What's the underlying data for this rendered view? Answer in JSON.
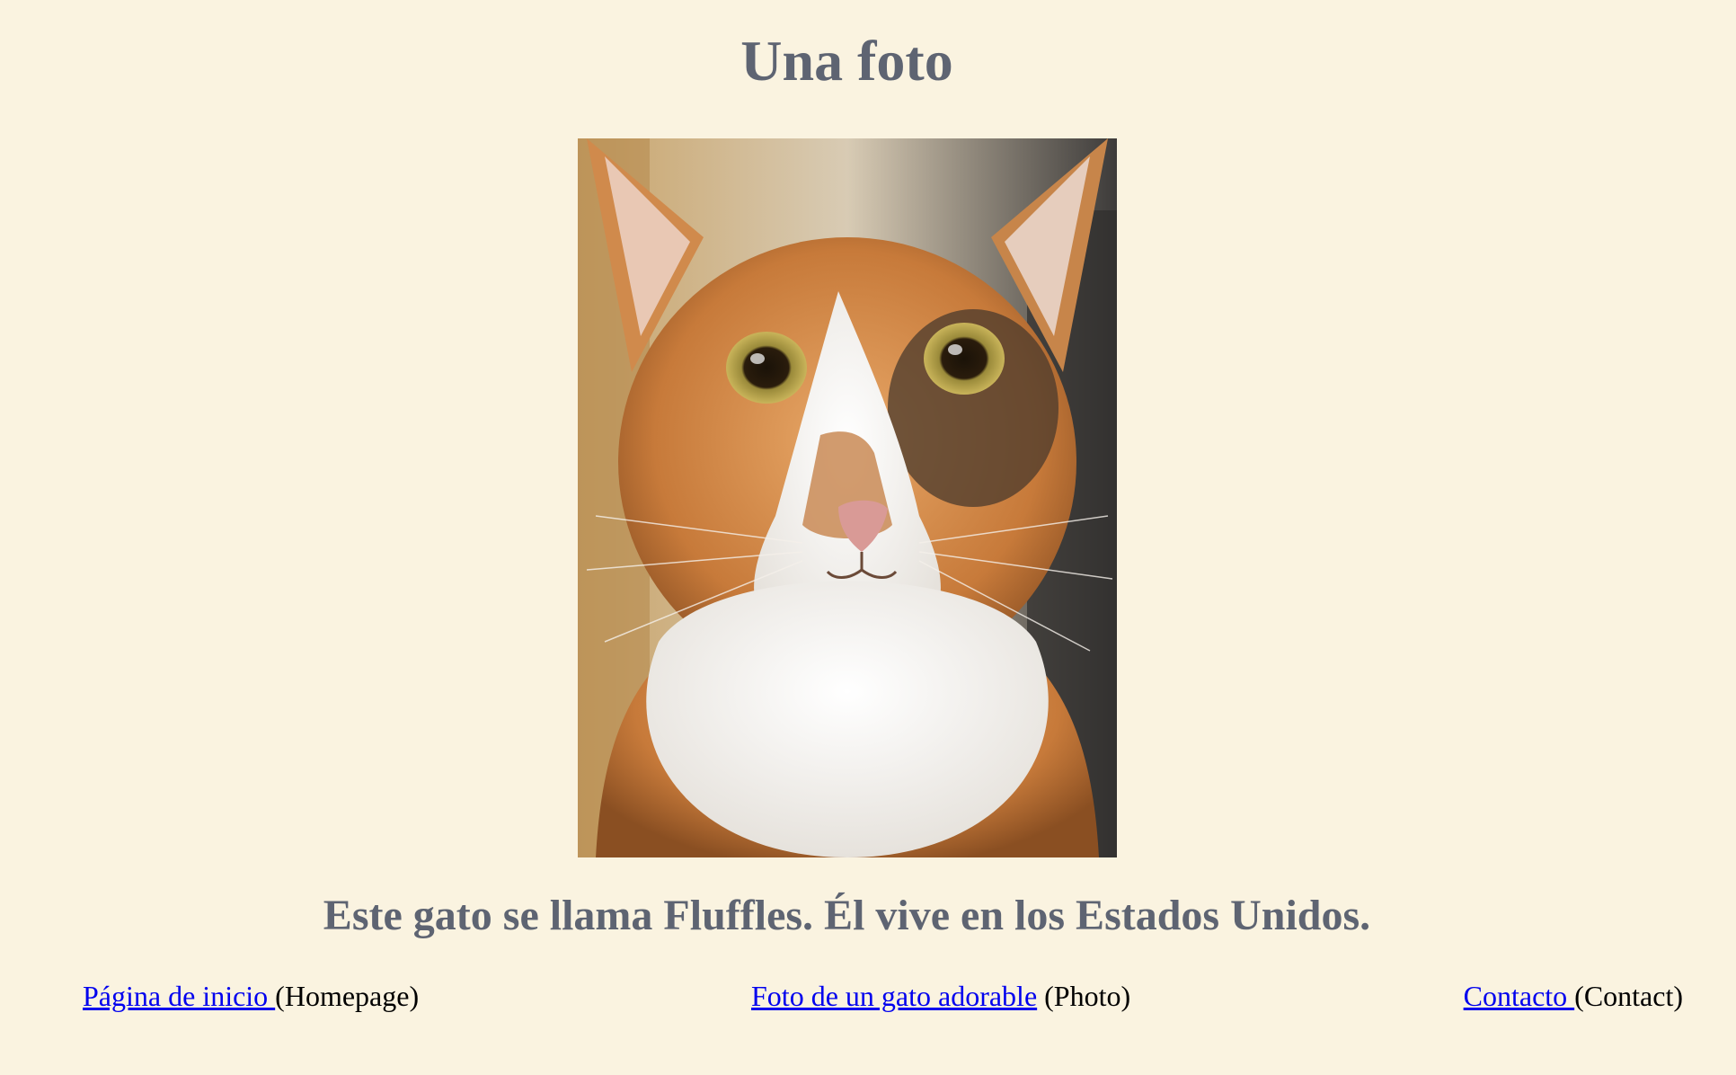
{
  "page": {
    "title": "Una foto",
    "caption": "Este gato se llama Fluffles. Él vive en los Estados Unidos."
  },
  "photo": {
    "subject": "orange-and-white-cat-photo"
  },
  "nav": {
    "items": [
      {
        "link_text": "Página de inicio ",
        "note": "(Homepage)"
      },
      {
        "link_text": "Foto de un gato adorable",
        "note": " (Photo)"
      },
      {
        "link_text": "Contacto ",
        "note": "(Contact)"
      }
    ]
  },
  "colors": {
    "background": "#faf3e0",
    "heading": "#5e6472",
    "link": "#0000ee"
  }
}
